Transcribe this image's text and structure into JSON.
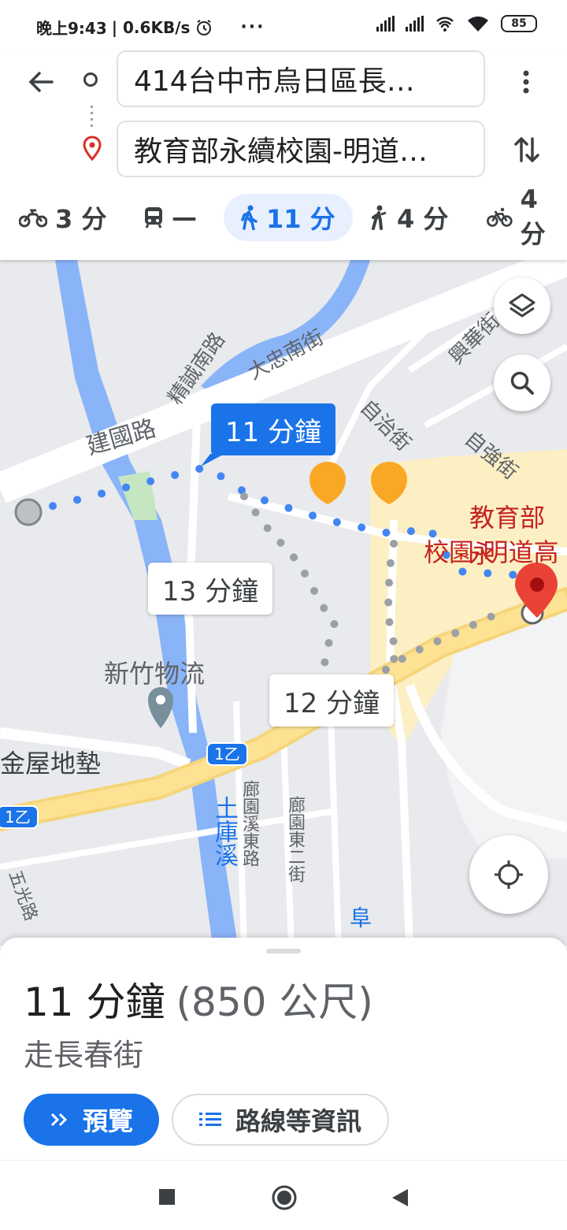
{
  "status_bar": {
    "time": "晚上9:43",
    "speed": "| 0.6KB/s",
    "more": "···",
    "battery": "85"
  },
  "directions": {
    "origin": "414台中市烏日區長…",
    "destination": "教育部永續校園-明道…",
    "modes": [
      {
        "icon": "motorcycle-icon",
        "value": "3 分"
      },
      {
        "icon": "transit-icon",
        "value": "—"
      },
      {
        "icon": "walk-icon",
        "value": "11 分",
        "active": true
      },
      {
        "icon": "rideshare-icon",
        "value": "4 分"
      },
      {
        "icon": "bicycle-icon",
        "value": "4 分"
      }
    ]
  },
  "map": {
    "streets": {
      "jianguo": "建國路",
      "jingcheng": "精誠南路",
      "dazhong": "大忠南街",
      "xinghua": "興華街",
      "zizhi": "自治街",
      "ziqiang": "自強街",
      "tukuxi": "土庫溪",
      "nanyuan_xidong": "廊園溪東路",
      "nanyuan_dong2": "廊園東二街",
      "wuguang": "五光路",
      "fu": "阜"
    },
    "places": {
      "xinzhu": "新竹物流",
      "jinwu": "金屋地墊",
      "dest_line1": "教育部永",
      "dest_line2": "校園-明道高"
    },
    "road_shields": [
      "1乙",
      "1乙"
    ],
    "route_tags": {
      "main": "11 分鐘",
      "alt1": "13 分鐘",
      "alt2": "12 分鐘"
    },
    "accent": "#1a73e8",
    "pin_color": "#ea4335"
  },
  "sheet": {
    "duration": "11 分鐘",
    "distance": "(850 公尺)",
    "via": "走長春街",
    "preview_label": "預覽",
    "steps_label": "路線等資訊"
  }
}
